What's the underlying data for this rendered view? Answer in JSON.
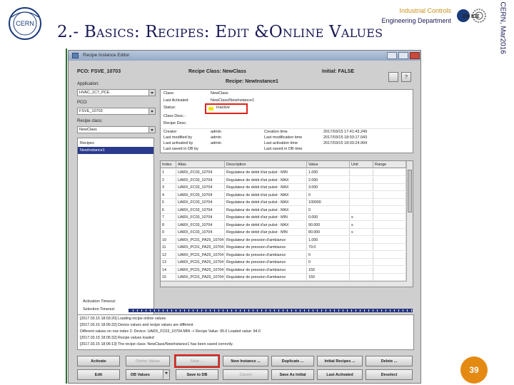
{
  "slide": {
    "title": "2.- Basics: Recipes: Edit &Online Values",
    "dept_top": "Industrial Controls",
    "dept_bottom": "Engineering Department",
    "side_text": "CERN, Mar2016",
    "page_number": "39",
    "cern_logo_text": "CERN",
    "en_logo_text": "EN ICE"
  },
  "window": {
    "title": "Recipe Instance Editor",
    "header": {
      "pco": "PCO: FSVE_10703",
      "recipe_class": "Recipe Class: NewClass",
      "initial": "Initial: FALSE",
      "recipe_name": "Recipe: NewInstance1"
    },
    "left": {
      "application_label": "Application:",
      "application_value": "HVAC_1C7_PCE",
      "pco_label": "PCO:",
      "pco_value": "FSVE_10703",
      "recipe_class_label": "Recipe class:",
      "recipe_class_value": "NewClass",
      "recipes": [
        {
          "label": "Recipes",
          "selected": false
        },
        {
          "label": "NewInstance1",
          "selected": true
        }
      ]
    },
    "info": {
      "rows": [
        {
          "label": "Class:",
          "value": "NewClass"
        },
        {
          "label": "Last Activated:",
          "value": "NewClass/NewInstance1"
        },
        {
          "label": "Status:",
          "value": "Inactive"
        },
        {
          "label": "Class Desc.:",
          "value": ""
        },
        {
          "label": "Recipe Desc:",
          "value": ""
        }
      ],
      "meta": [
        {
          "c1": "Creator",
          "c2": "admin",
          "c3": "Creation time",
          "c4": "2017/03/15 17:41:43.249"
        },
        {
          "c1": "Last modified by",
          "c2": "admin",
          "c3": "Last modification time",
          "c4": "2017/03/15 18:03:17.043"
        },
        {
          "c1": "Last activated by",
          "c2": "admin",
          "c3": "Last activation time",
          "c4": "2017/03/15 18:03:24.994"
        },
        {
          "c1": "Last saved in DB by",
          "c2": "",
          "c3": "Last saved in DB time",
          "c4": ""
        }
      ],
      "status_color": "#f0e800"
    },
    "table": {
      "headers": [
        "Index",
        "Alias",
        "Description",
        "Value",
        "Unit",
        "Range"
      ],
      "rows": [
        [
          "1",
          "UARX_FC03_10704",
          "Regulateur de debit d'air pulsé : MIN",
          "1.000",
          "",
          ""
        ],
        [
          "2",
          "UARX_FC03_10704",
          "Regulateur de debit d'air pulsé : MAX",
          "2.000",
          "",
          ""
        ],
        [
          "3",
          "UARX_FC03_10704",
          "Regulateur de debit d'air pulsé : MAX",
          "3.000",
          "",
          ""
        ],
        [
          "4",
          "UARX_FC03_10704",
          "Regulateur de debit d'air pulsé : MAX",
          "0",
          "",
          ""
        ],
        [
          "5",
          "UARX_FC03_10704",
          "Regulateur de debit d'air pulsé : MAX",
          "100000",
          "",
          ""
        ],
        [
          "6",
          "UARX_FC03_10704",
          "Regulateur de debit d'air pulsé : MAX",
          "0",
          "",
          ""
        ],
        [
          "7",
          "UARX_FC03_10704",
          "Regulateur de debit d'air pulsé : MIN",
          "0.000",
          "s",
          ""
        ],
        [
          "8",
          "UARX_FC03_10704",
          "Regulateur de debit d'air pulsé : MAX",
          "90.000",
          "s",
          ""
        ],
        [
          "9",
          "UARX_FC03_10704",
          "Regulateur de debit d'air pulsé : MIN",
          "80.000",
          "s",
          ""
        ],
        [
          "10",
          "UARX_PC01_PA25_10704",
          "Regulateur de pression d'ambiance",
          "1.000",
          "",
          ""
        ],
        [
          "11",
          "UARX_PC01_PA25_10704",
          "Regulateur de pression d'ambiance",
          "79.0",
          "",
          ""
        ],
        [
          "12",
          "UARX_PC01_PA25_10704",
          "Regulateur de pression d'ambiance",
          "0",
          "",
          ""
        ],
        [
          "13",
          "UARX_PC01_PA25_10704",
          "Regulateur de pression d'ambiance",
          "0",
          "",
          ""
        ],
        [
          "14",
          "UARX_PC01_PA25_10704",
          "Regulateur de pression d'ambiance",
          "150",
          "",
          ""
        ],
        [
          "15",
          "UARX_PC01_PA25_10704",
          "Regulateur de pression d'ambiance",
          "150",
          "",
          ""
        ]
      ]
    },
    "filters": {
      "activation": "Activation Timeout:",
      "selection": "Selection Timeout:"
    },
    "log": [
      "[2017.03.15 18:03:20] Loading recipe online values",
      "[2017.03.15 18:05:32] Device values and recipe values are different",
      "Different values on row index 3: Device: UARX_FC03_10704.MIN -> Recipe Value: 95.0 Loaded value: 94.0",
      "[2017.03.15 18:05:32] Recipe values loaded",
      "[2017.03.15 18:06:13] The recipe class: NewClass/NewInstance1 has been saved correctly."
    ],
    "buttons_row1": [
      {
        "label": "Activate",
        "disabled": false
      },
      {
        "label": "Online Values",
        "disabled": true
      },
      {
        "label": "Save ...",
        "disabled": true
      },
      {
        "label": "New Instance ...",
        "disabled": false
      },
      {
        "label": "Duplicate ...",
        "disabled": false
      },
      {
        "label": "Initial Recipes ...",
        "disabled": false
      },
      {
        "label": "Delete ...",
        "disabled": false
      }
    ],
    "buttons_row2": [
      {
        "label": "Edit",
        "disabled": false
      },
      {
        "label": "DB Values",
        "disabled": false
      },
      {
        "label": "Save to DB",
        "disabled": false
      },
      {
        "label": "Cancel",
        "disabled": true
      },
      {
        "label": "Save As Initial",
        "disabled": false
      },
      {
        "label": "Last Activated",
        "disabled": false
      },
      {
        "label": "Deselect",
        "disabled": false
      }
    ]
  }
}
